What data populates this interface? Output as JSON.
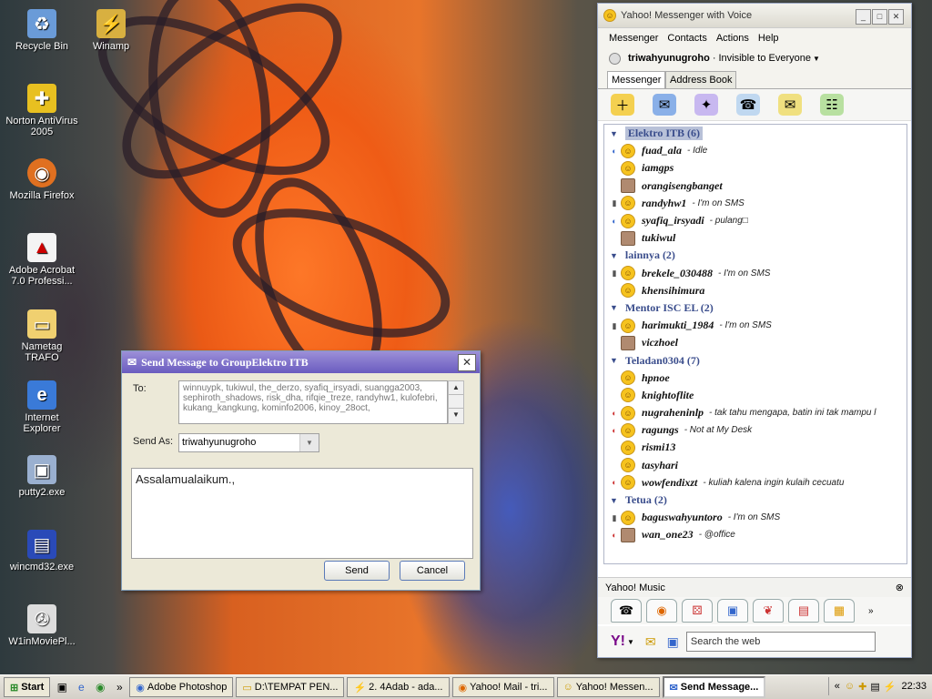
{
  "desktop": {
    "icons": [
      {
        "label": "Recycle Bin",
        "icon": "recycle-bin-icon"
      },
      {
        "label": "Winamp",
        "icon": "winamp-icon"
      },
      {
        "label": "Norton AntiVirus 2005",
        "icon": "norton-icon"
      },
      {
        "label": "Mozilla Firefox",
        "icon": "firefox-icon"
      },
      {
        "label": "Adobe Acrobat 7.0 Professi...",
        "icon": "acrobat-icon"
      },
      {
        "label": "Nametag TRAFO",
        "icon": "folder-icon"
      },
      {
        "label": "Internet Explorer",
        "icon": "ie-icon"
      },
      {
        "label": "putty2.exe",
        "icon": "putty-icon"
      },
      {
        "label": "wincmd32.exe",
        "icon": "floppy-icon"
      },
      {
        "label": "W1inMoviePl...",
        "icon": "movie-icon"
      }
    ]
  },
  "send_dialog": {
    "title": "Send Message to GroupElektro ITB",
    "to_label": "To:",
    "to_value": "winnuypk, tukiwul, the_derzo, syafiq_irsyadi, suangga2003, sephiroth_shadows, risk_dha, rifqie_treze, randyhw1, kulofebri, kukang_kangkung, kominfo2006, kinoy_28oct,",
    "send_as_label": "Send As:",
    "send_as_value": "triwahyunugroho",
    "message": "Assalamualaikum.,",
    "send_button": "Send",
    "cancel_button": "Cancel"
  },
  "messenger": {
    "title": "Yahoo! Messenger with Voice",
    "menu": [
      "Messenger",
      "Contacts",
      "Actions",
      "Help"
    ],
    "user": "triwahyunugroho",
    "status": "Invisible to Everyone",
    "tabs": [
      "Messenger",
      "Address Book"
    ],
    "groups": [
      {
        "name": "Elektro ITB (6)",
        "selected": true,
        "contacts": [
          {
            "name": "fuad_ala",
            "status": "- Idle",
            "ind": "voice",
            "avatar": "smiley"
          },
          {
            "name": "iamgps",
            "status": "",
            "ind": "",
            "avatar": "smiley"
          },
          {
            "name": "orangisengbanget",
            "status": "",
            "ind": "",
            "avatar": "photo"
          },
          {
            "name": "randyhw1",
            "status": "- I'm on SMS",
            "ind": "mobile",
            "avatar": "smiley"
          },
          {
            "name": "syafiq_irsyadi",
            "status": "- pulang□",
            "ind": "voice",
            "avatar": "smiley"
          },
          {
            "name": "tukiwul",
            "status": "",
            "ind": "",
            "avatar": "photo"
          }
        ]
      },
      {
        "name": "lainnya (2)",
        "selected": false,
        "contacts": [
          {
            "name": "brekele_030488",
            "status": "- I'm on SMS",
            "ind": "mobile",
            "avatar": "smiley"
          },
          {
            "name": "khensihimura",
            "status": "",
            "ind": "",
            "avatar": "smiley"
          }
        ]
      },
      {
        "name": "Mentor ISC EL (2)",
        "selected": false,
        "contacts": [
          {
            "name": "harimukti_1984",
            "status": "- I'm on SMS",
            "ind": "mobile",
            "avatar": "smiley"
          },
          {
            "name": "viczhoel",
            "status": "",
            "ind": "",
            "avatar": "photo"
          }
        ]
      },
      {
        "name": "Teladan0304 (7)",
        "selected": false,
        "contacts": [
          {
            "name": "hpnoe",
            "status": "",
            "ind": "",
            "avatar": "smiley"
          },
          {
            "name": "knightoflite",
            "status": "",
            "ind": "",
            "avatar": "smiley"
          },
          {
            "name": "nugraheninlp",
            "status": "- tak tahu mengapa, batin ini tak mampu l",
            "ind": "busy",
            "avatar": "smiley"
          },
          {
            "name": "ragungs",
            "status": "- Not at My Desk",
            "ind": "busy",
            "avatar": "smiley"
          },
          {
            "name": "rismi13",
            "status": "",
            "ind": "",
            "avatar": "smiley"
          },
          {
            "name": "tasyhari",
            "status": "",
            "ind": "",
            "avatar": "smiley"
          },
          {
            "name": "wowfendixzt",
            "status": "- kuliah kalena ingin kulaih cecuatu",
            "ind": "busy",
            "avatar": "smiley"
          }
        ]
      },
      {
        "name": "Tetua (2)",
        "selected": false,
        "contacts": [
          {
            "name": "baguswahyuntoro",
            "status": "- I'm on SMS",
            "ind": "mobile",
            "avatar": "smiley"
          },
          {
            "name": "wan_one23",
            "status": "- @office",
            "ind": "busy",
            "avatar": "photo"
          }
        ]
      }
    ],
    "music_label": "Yahoo! Music",
    "search_placeholder": "Search the web"
  },
  "taskbar": {
    "start": "Start",
    "tasks": [
      {
        "label": "Adobe Photoshop",
        "active": false
      },
      {
        "label": "D:\\TEMPAT PEN...",
        "active": false
      },
      {
        "label": "2. 4Adab - ada...",
        "active": false
      },
      {
        "label": "Yahoo! Mail - tri...",
        "active": false
      },
      {
        "label": "Yahoo! Messen...",
        "active": false
      },
      {
        "label": "Send Message...",
        "active": true
      }
    ],
    "clock": "22:33"
  }
}
